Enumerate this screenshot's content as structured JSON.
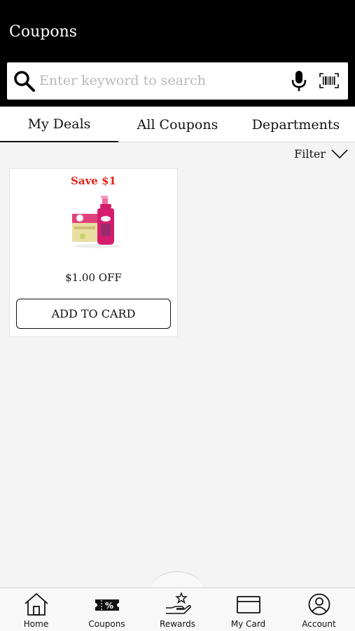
{
  "header": {
    "title": "Coupons"
  },
  "search": {
    "placeholder": "Enter keyword to search"
  },
  "tabs": [
    {
      "label": "My Deals",
      "active": true
    },
    {
      "label": "All Coupons",
      "active": false
    },
    {
      "label": "Departments",
      "active": false
    }
  ],
  "filter": {
    "label": "Filter"
  },
  "coupon": {
    "save_label": "Save $1",
    "offer": "$1.00 OFF",
    "button": "ADD TO CARD",
    "accent_color": "#e32419"
  },
  "bottom_nav": [
    {
      "label": "Home",
      "icon": "home-icon"
    },
    {
      "label": "Coupons",
      "icon": "coupon-ticket-icon"
    },
    {
      "label": "Rewards",
      "icon": "rewards-hand-star-icon"
    },
    {
      "label": "My Card",
      "icon": "card-icon"
    },
    {
      "label": "Account",
      "icon": "account-icon"
    }
  ]
}
